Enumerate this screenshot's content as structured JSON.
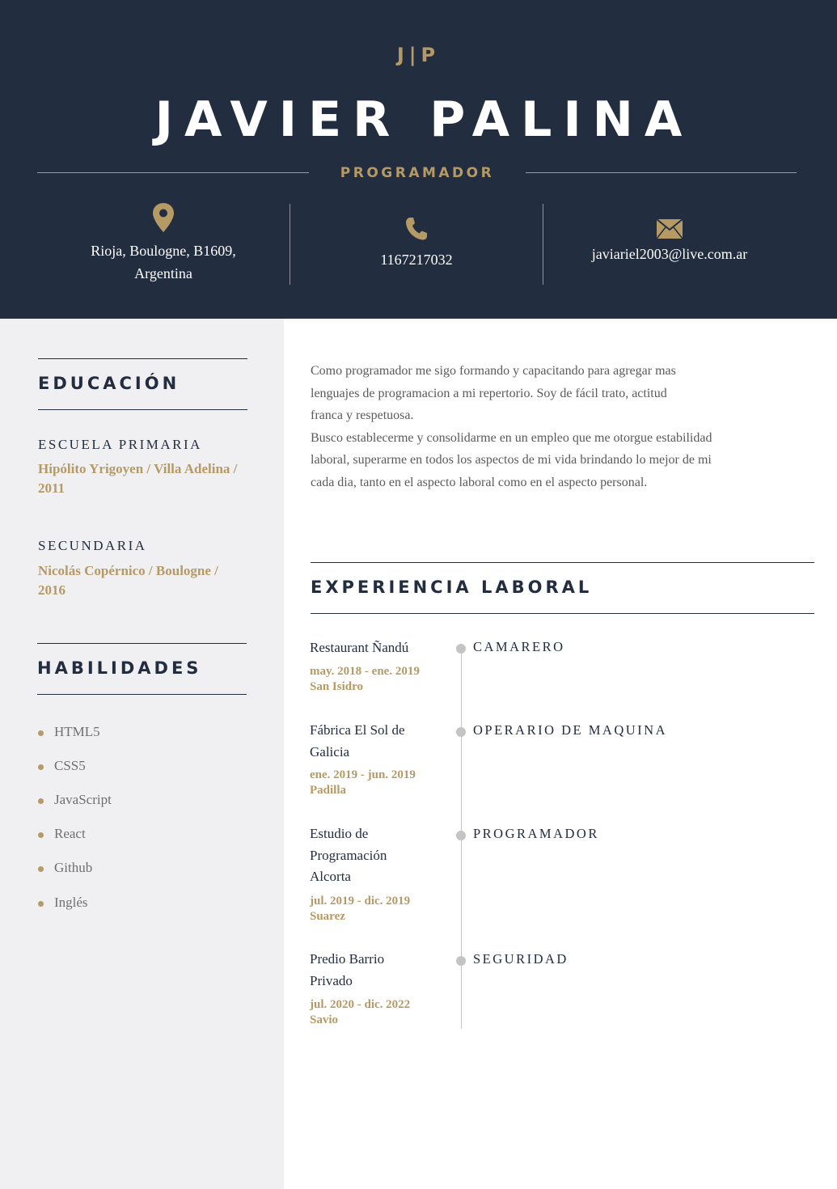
{
  "header": {
    "monogram": "J|P",
    "name": "JAVIER PALINA",
    "role": "PROGRAMADOR"
  },
  "contact": {
    "address_line1": "Rioja, Boulogne, B1609,",
    "address_line2": "Argentina",
    "phone": "1167217032",
    "email": "javiariel2003@live.com.ar",
    "icons": [
      "location-pin-icon",
      "phone-icon",
      "envelope-icon"
    ]
  },
  "education": {
    "title": "EDUCACIÓN",
    "items": [
      {
        "level": "ESCUELA PRIMARIA",
        "detail": "Hipólito Yrigoyen / Villa Adelina / 2011"
      },
      {
        "level": "SECUNDARIA",
        "detail": "Nicolás Copérnico / Boulogne / 2016"
      }
    ]
  },
  "skills": {
    "title": "HABILIDADES",
    "items": [
      "HTML5",
      "CSS5",
      "JavaScript",
      "React",
      "Github",
      "Inglés"
    ]
  },
  "profile": {
    "lines": [
      "Como programador me sigo formando y capacitando para agregar mas",
      "lenguajes de programacion a mi repertorio. Soy de fácil trato, actitud",
      "franca y respetuosa.",
      "Busco establecerme y consolidarme en un empleo que me otorgue estabilidad",
      "laboral, superarme en todos los aspectos de mi vida brindando lo mejor de mi",
      "cada dia, tanto en el aspecto laboral como en el aspecto personal."
    ]
  },
  "experience": {
    "title": "EXPERIENCIA LABORAL",
    "jobs": [
      {
        "company": "Restaurant Ñandú",
        "dates": "may. 2018 - ene. 2019",
        "place": "San Isidro",
        "role": "CAMARERO"
      },
      {
        "company": "Fábrica El Sol de Galicia",
        "dates": "ene. 2019 - jun. 2019",
        "place": "Padilla",
        "role": "OPERARIO DE MAQUINA"
      },
      {
        "company": "Estudio de Programación Alcorta",
        "dates": "jul. 2019 - dic. 2019",
        "place": "Suarez",
        "role": "PROGRAMADOR"
      },
      {
        "company": "Predio Barrio Privado",
        "dates": "jul. 2020 - dic. 2022",
        "place": "Savio",
        "role": "SEGURIDAD"
      }
    ]
  },
  "colors": {
    "navy": "#232d40",
    "gold": "#b59a65",
    "sidebar_bg": "#f0f0f2"
  }
}
